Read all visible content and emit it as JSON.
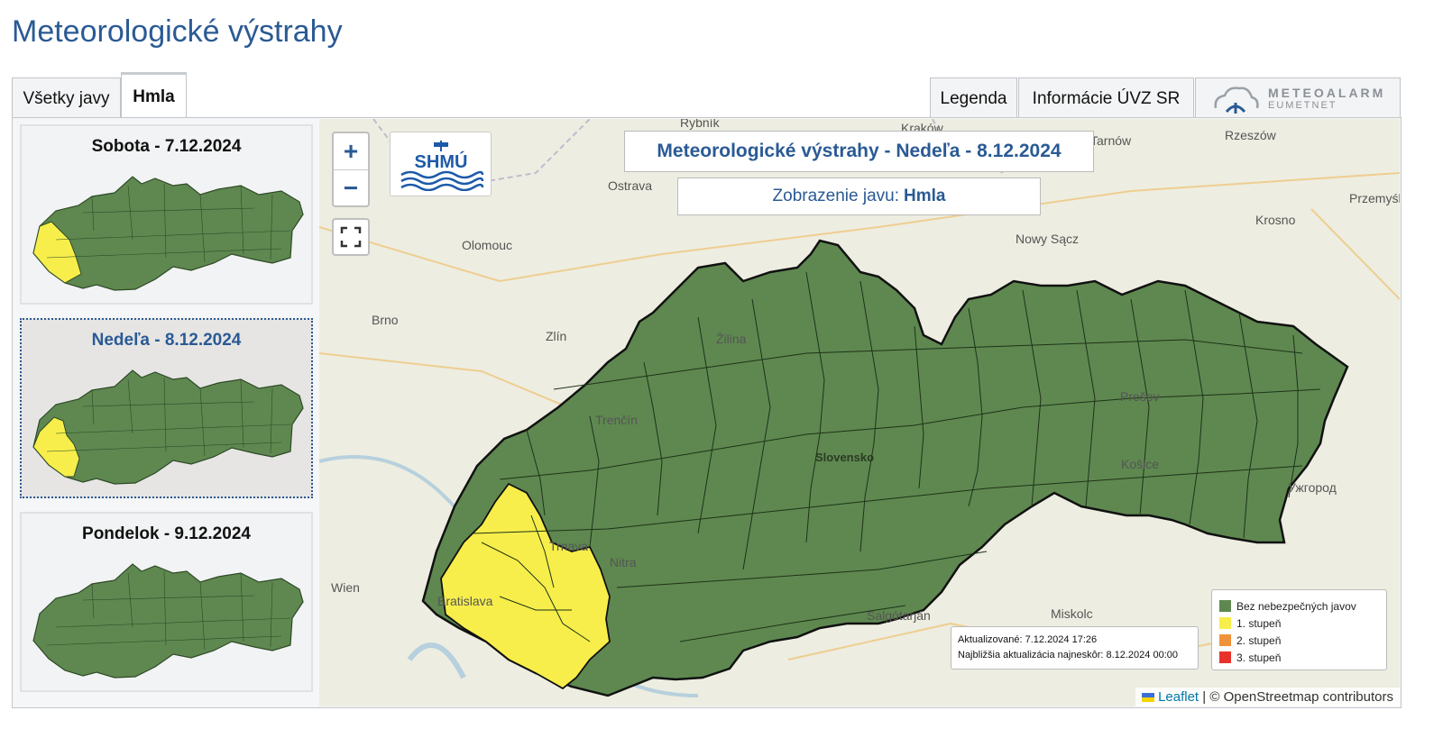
{
  "page": {
    "title": "Meteorologické výstrahy"
  },
  "tabs": [
    {
      "label": "Všetky javy",
      "active": false
    },
    {
      "label": "Hmla",
      "active": true
    }
  ],
  "right_buttons": {
    "legend": "Legenda",
    "uvz": "Informácie ÚVZ SR"
  },
  "meteoalarm": {
    "name": "METEOALARM",
    "sub": "EUMETNET"
  },
  "days": [
    {
      "label": "Sobota - 7.12.2024",
      "selected": false
    },
    {
      "label": "Nedeľa - 8.12.2024",
      "selected": true
    },
    {
      "label": "Pondelok - 9.12.2024",
      "selected": false
    }
  ],
  "map": {
    "title": "Meteorologické výstrahy - Nedeľa - 8.12.2024",
    "subtitle_prefix": "Zobrazenie javu:",
    "subtitle_value": "Hmla",
    "zoom_in": "+",
    "zoom_out": "−",
    "logo_text": "SHMÚ",
    "update_line1": "Aktualizované: 7.12.2024 17:26",
    "update_line2": "Najbližšia aktualizácia najneskôr: 8.12.2024 00:00",
    "legend": [
      {
        "label": "Bez nebezpečných javov",
        "color": "#5e8850"
      },
      {
        "label": "1. stupeň",
        "color": "#f7ee4b"
      },
      {
        "label": "2. stupeň",
        "color": "#f0923a"
      },
      {
        "label": "3. stupeň",
        "color": "#e8312a"
      }
    ],
    "attribution_link": "Leaflet",
    "attribution_text": "| © OpenStreetmap contributors",
    "places": [
      "Rybník",
      "Kraków",
      "Tarnów",
      "Rzeszów",
      "Przemyśl",
      "Ostrava",
      "Olomouc",
      "Nowy Sącz",
      "Krosno",
      "Brno",
      "Zlín",
      "Žilina",
      "Trenčín",
      "Prešov",
      "Slovensko",
      "Košice",
      "Ужгород",
      "Trnava",
      "Nitra",
      "Bratislava",
      "Wien",
      "Salgótarján",
      "Miskolc"
    ]
  },
  "colors": {
    "green": "#5e8850",
    "yellow": "#f7ee4b",
    "accent": "#2a5a94"
  }
}
